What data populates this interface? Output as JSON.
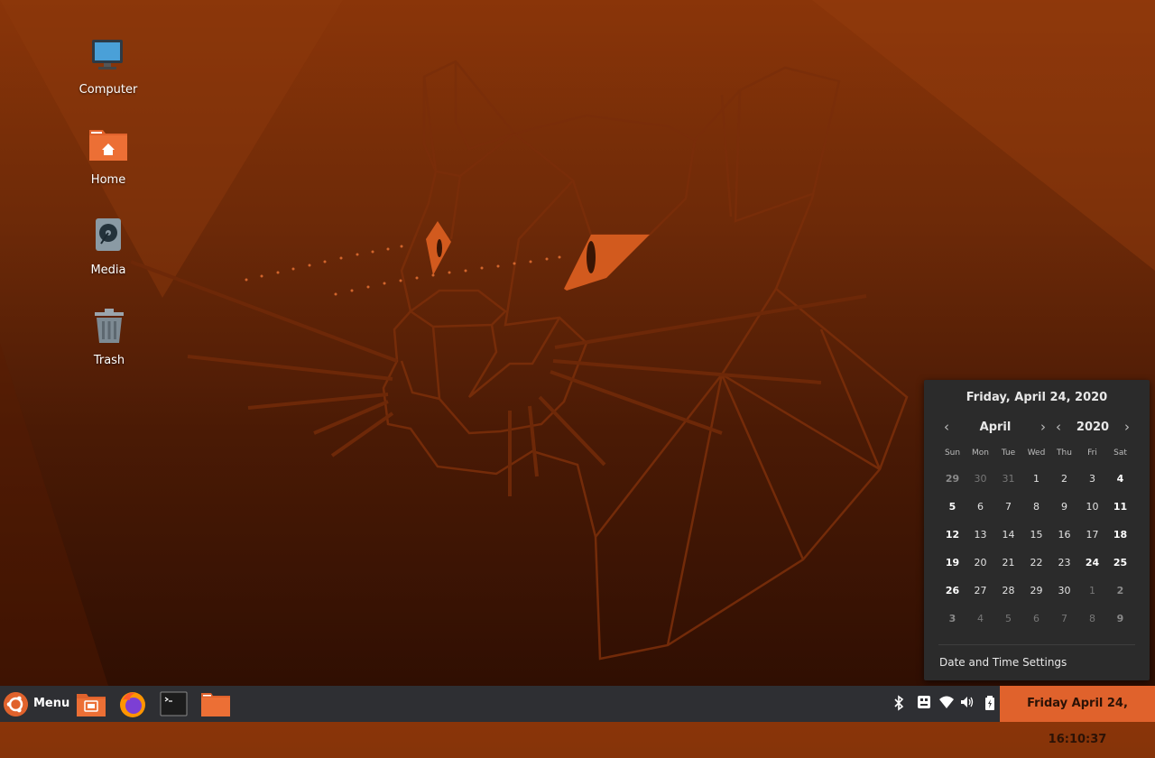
{
  "desktop": {
    "icons": [
      {
        "label": "Computer"
      },
      {
        "label": "Home"
      },
      {
        "label": "Media"
      },
      {
        "label": "Trash"
      }
    ]
  },
  "calendar": {
    "title": "Friday, April 24, 2020",
    "month": "April",
    "year": "2020",
    "weekdays": [
      "Sun",
      "Mon",
      "Tue",
      "Wed",
      "Thu",
      "Fri",
      "Sat"
    ],
    "weeks": [
      [
        "29",
        "30",
        "31",
        "1",
        "2",
        "3",
        "4"
      ],
      [
        "5",
        "6",
        "7",
        "8",
        "9",
        "10",
        "11"
      ],
      [
        "12",
        "13",
        "14",
        "15",
        "16",
        "17",
        "18"
      ],
      [
        "19",
        "20",
        "21",
        "22",
        "23",
        "24",
        "25"
      ],
      [
        "26",
        "27",
        "28",
        "29",
        "30",
        "1",
        "2"
      ],
      [
        "3",
        "4",
        "5",
        "6",
        "7",
        "8",
        "9"
      ]
    ],
    "today": "24",
    "settings_label": "Date and Time Settings"
  },
  "panel": {
    "menu_label": "Menu",
    "launchers": [
      "file-manager-icon",
      "firefox-icon",
      "terminal-icon",
      "folder-icon"
    ],
    "tray": [
      "bluetooth-icon",
      "keyboard-icon",
      "wifi-icon",
      "volume-icon",
      "battery-icon"
    ],
    "clock": "Friday April 24, 16:10:37"
  },
  "colors": {
    "accent": "#e0622c",
    "panel_bg": "#2e2f33",
    "popup_bg": "#2b2b2b"
  }
}
